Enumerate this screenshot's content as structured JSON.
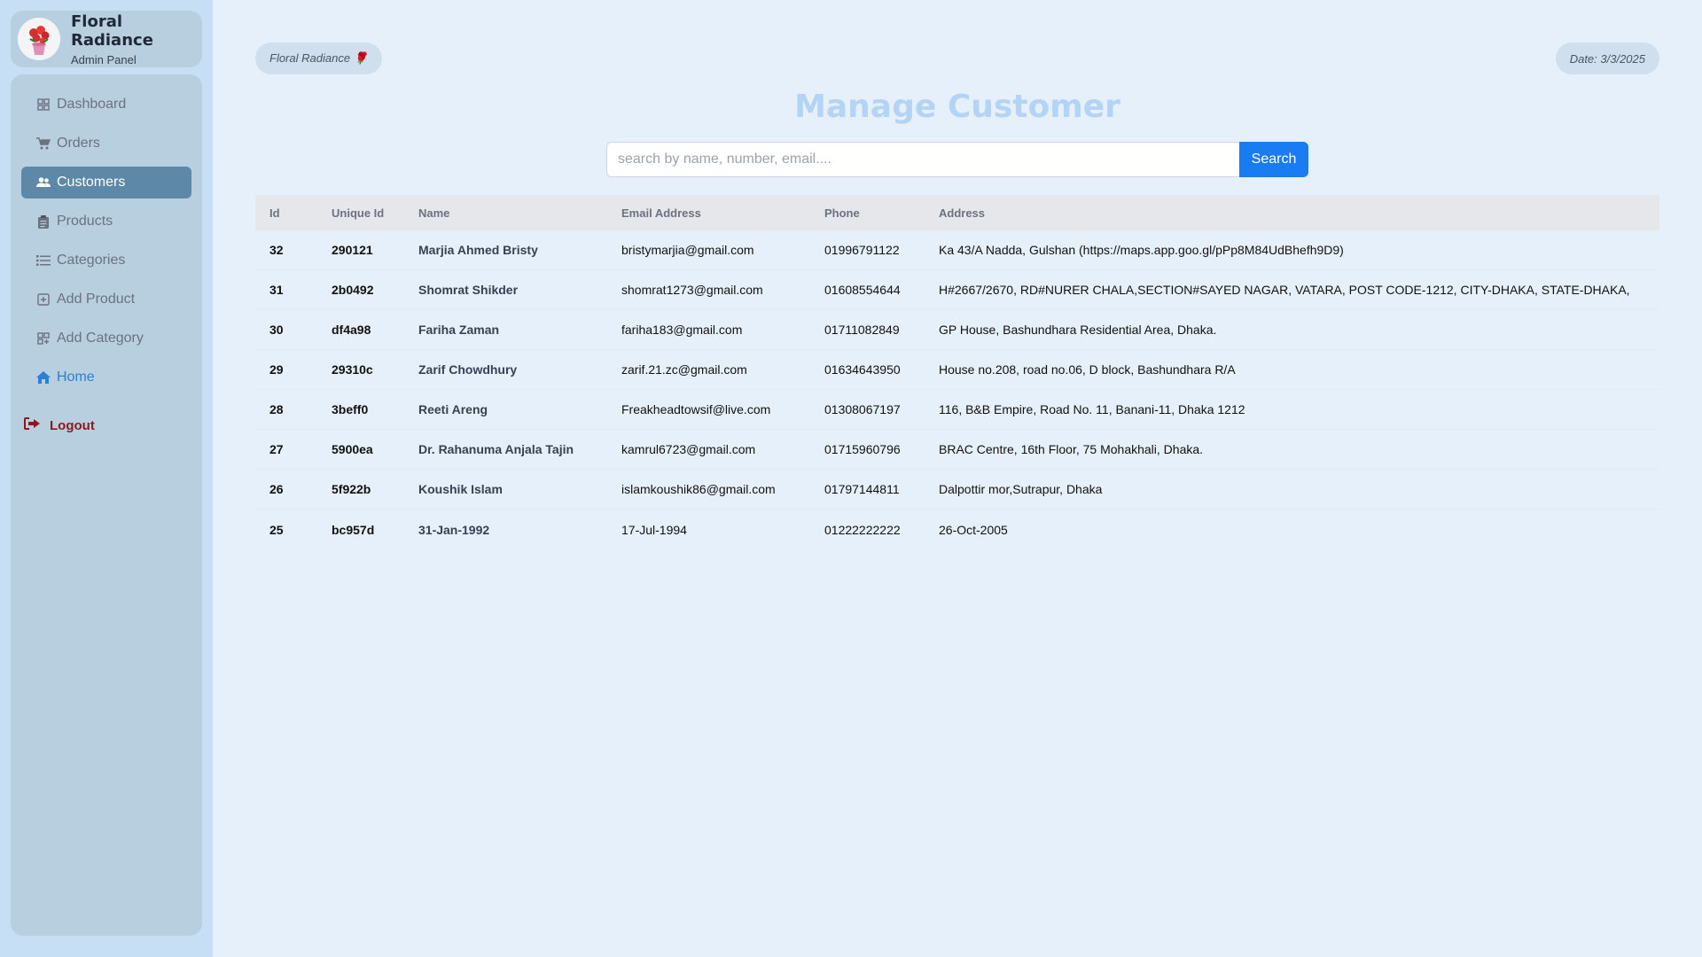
{
  "brand": {
    "title": "Floral Radiance",
    "subtitle": "Admin Panel"
  },
  "nav": [
    {
      "label": "Dashboard",
      "icon": "grid-icon",
      "state": "normal"
    },
    {
      "label": "Orders",
      "icon": "cart-icon",
      "state": "normal"
    },
    {
      "label": "Customers",
      "icon": "users-icon",
      "state": "active"
    },
    {
      "label": "Products",
      "icon": "clipboard-icon",
      "state": "normal"
    },
    {
      "label": "Categories",
      "icon": "list-icon",
      "state": "normal"
    },
    {
      "label": "Add Product",
      "icon": "plus-square-icon",
      "state": "normal"
    },
    {
      "label": "Add Category",
      "icon": "grid-plus-icon",
      "state": "normal"
    },
    {
      "label": "Home",
      "icon": "home-icon",
      "state": "link"
    }
  ],
  "logout": {
    "label": "Logout"
  },
  "header": {
    "brand_pill": "Floral Radiance 🌹",
    "date_pill": "Date: 3/3/2025"
  },
  "page_title": "Manage Customer",
  "search": {
    "placeholder": "search by name, number, email....",
    "value": "",
    "button_label": "Search"
  },
  "table": {
    "columns": [
      "Id",
      "Unique Id",
      "Name",
      "Email Address",
      "Phone",
      "Address"
    ],
    "rows": [
      {
        "id": "32",
        "uid": "290121",
        "name": "Marjia Ahmed Bristy",
        "email": "bristymarjia@gmail.com",
        "phone": "01996791122",
        "address": "Ka 43/A Nadda, Gulshan (https://maps.app.goo.gl/pPp8M84UdBhefh9D9)"
      },
      {
        "id": "31",
        "uid": "2b0492",
        "name": "Shomrat Shikder",
        "email": "shomrat1273@gmail.com",
        "phone": "01608554644",
        "address": "H#2667/2670, RD#NURER CHALA,SECTION#SAYED NAGAR, VATARA, POST CODE-1212, CITY-DHAKA, STATE-DHAKA,"
      },
      {
        "id": "30",
        "uid": "df4a98",
        "name": "Fariha Zaman",
        "email": "fariha183@gmail.com",
        "phone": "01711082849",
        "address": "GP House, Bashundhara Residential Area, Dhaka."
      },
      {
        "id": "29",
        "uid": "29310c",
        "name": "Zarif Chowdhury",
        "email": "zarif.21.zc@gmail.com",
        "phone": "01634643950",
        "address": "House no.208, road no.06, D block, Bashundhara R/A"
      },
      {
        "id": "28",
        "uid": "3beff0",
        "name": "Reeti Areng",
        "email": "Freakheadtowsif@live.com",
        "phone": "01308067197",
        "address": "116, B&B Empire, Road No. 11, Banani-11, Dhaka 1212"
      },
      {
        "id": "27",
        "uid": "5900ea",
        "name": "Dr. Rahanuma Anjala Tajin",
        "email": "kamrul6723@gmail.com",
        "phone": "01715960796",
        "address": "BRAC Centre, 16th Floor, 75 Mohakhali, Dhaka."
      },
      {
        "id": "26",
        "uid": "5f922b",
        "name": "Koushik Islam",
        "email": "islamkoushik86@gmail.com",
        "phone": "01797144811",
        "address": "Dalpottir mor,Sutrapur, Dhaka"
      },
      {
        "id": "25",
        "uid": "bc957d",
        "name": "31-Jan-1992",
        "email": "17-Jul-1994",
        "phone": "01222222222",
        "address": "26-Oct-2005"
      }
    ]
  }
}
